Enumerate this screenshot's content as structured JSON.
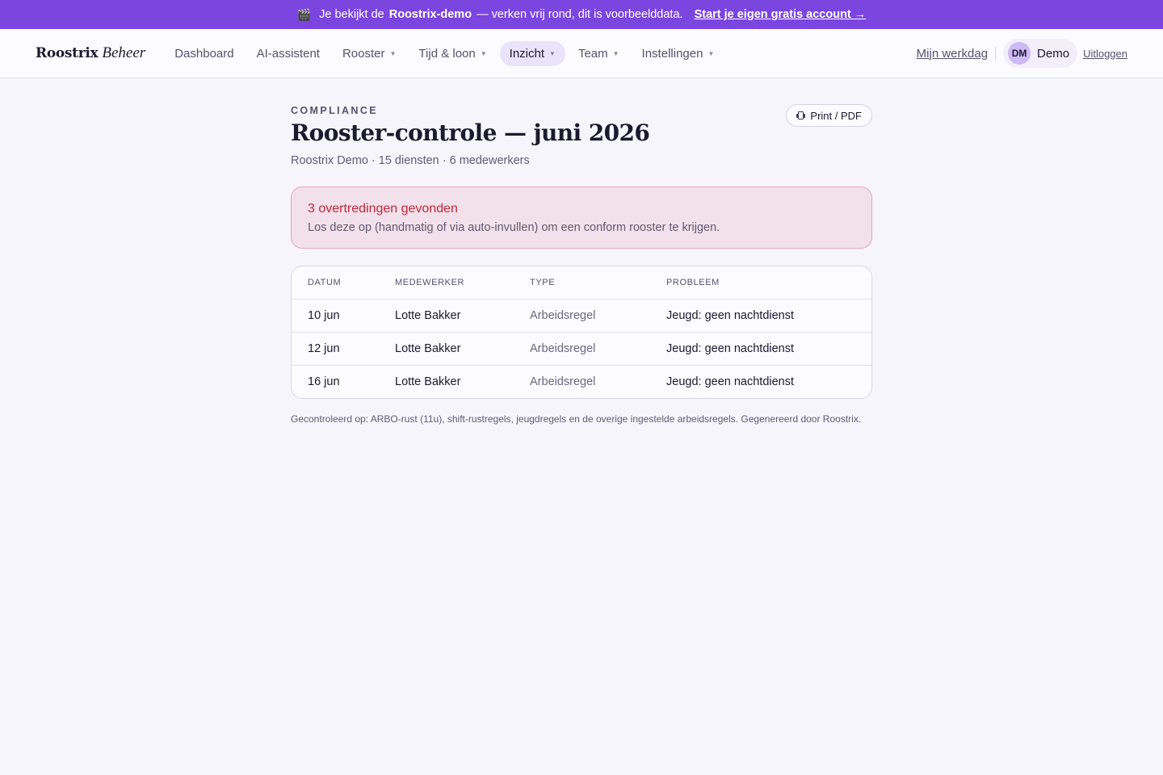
{
  "banner": {
    "icon": "clapperboard-icon",
    "prefix": "Je bekijkt de",
    "product": "Roostrix-demo",
    "suffix": "— verken vrij rond, dit is voorbeelddata.",
    "cta": "Start je eigen gratis account →",
    "color": "#7b45e0"
  },
  "nav": {
    "brand_main": "Roostrix",
    "brand_sub": "Beheer",
    "items": [
      {
        "label": "Dashboard",
        "dropdown": false,
        "active": false
      },
      {
        "label": "AI-assistent",
        "dropdown": false,
        "active": false
      },
      {
        "label": "Rooster",
        "dropdown": true,
        "active": false
      },
      {
        "label": "Tijd & loon",
        "dropdown": true,
        "active": false
      },
      {
        "label": "Inzicht",
        "dropdown": true,
        "active": true
      },
      {
        "label": "Team",
        "dropdown": true,
        "active": false
      },
      {
        "label": "Instellingen",
        "dropdown": true,
        "active": false
      }
    ],
    "my_workday": "Mijn werkdag",
    "user_initials": "DM",
    "user_name": "Demo",
    "logout": "Uitloggen"
  },
  "page": {
    "eyebrow": "COMPLIANCE",
    "title": "Rooster-controle — juni 2026",
    "subtitle": "Roostrix Demo · 15 diensten · 6 medewerkers",
    "print_label": "Print / PDF"
  },
  "alert": {
    "title": "3 overtredingen gevonden",
    "text": "Los deze op (handmatig of via auto-invullen) om een conform rooster te krijgen.",
    "color": "#c0283a"
  },
  "table": {
    "headers": [
      "DATUM",
      "MEDEWERKER",
      "TYPE",
      "PROBLEEM"
    ],
    "rows": [
      [
        "10 jun",
        "Lotte Bakker",
        "Arbeidsregel",
        "Jeugd: geen nachtdienst"
      ],
      [
        "12 jun",
        "Lotte Bakker",
        "Arbeidsregel",
        "Jeugd: geen nachtdienst"
      ],
      [
        "16 jun",
        "Lotte Bakker",
        "Arbeidsregel",
        "Jeugd: geen nachtdienst"
      ]
    ]
  },
  "footnote": "Gecontroleerd op: ARBO-rust (11u), shift-rustregels, jeugdregels en de overige ingestelde arbeidsregels. Gegenereerd door Roostrix."
}
